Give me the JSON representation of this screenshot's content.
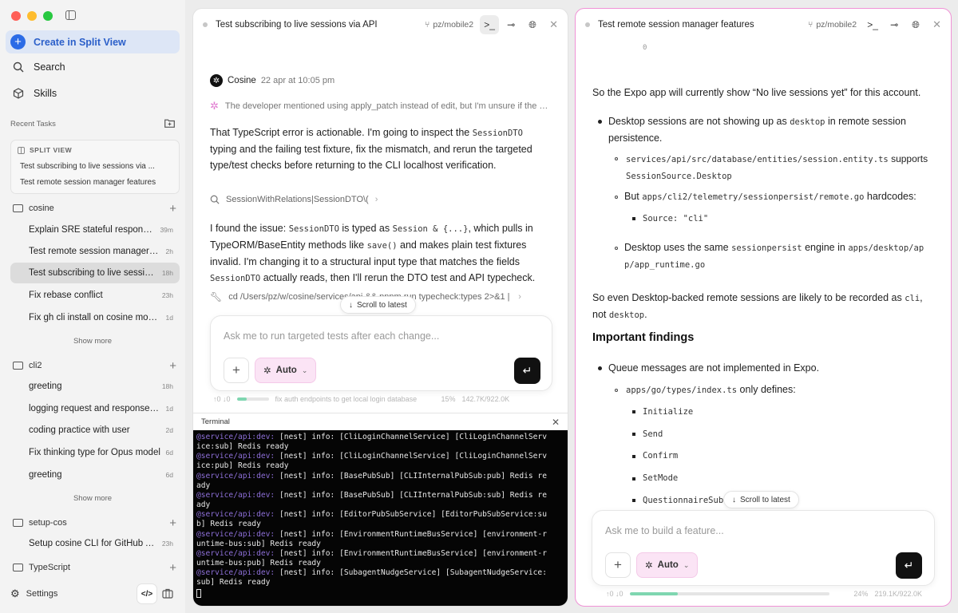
{
  "sidebar": {
    "create_label": "Create in Split View",
    "nav": [
      {
        "label": "Search",
        "icon": "search-icon"
      },
      {
        "label": "Skills",
        "icon": "cube-icon"
      }
    ],
    "recent_tasks_label": "Recent Tasks",
    "split_view": {
      "label": "SPLIT VIEW",
      "items": [
        "Test subscribing to live sessions via ...",
        "Test remote session manager features"
      ]
    },
    "groups": [
      {
        "name": "cosine",
        "tasks": [
          {
            "title": "Explain SRE stateful responses...",
            "age": "39m"
          },
          {
            "title": "Test remote session manager fea...",
            "age": "2h"
          },
          {
            "title": "Test subscribing to live sessions...",
            "age": "18h",
            "selected": true
          },
          {
            "title": "Fix rebase conflict",
            "age": "23h"
          },
          {
            "title": "Fix gh cli install on cosine monor...",
            "age": "1d"
          }
        ],
        "show_more": "Show more"
      },
      {
        "name": "cli2",
        "tasks": [
          {
            "title": "greeting",
            "age": "18h"
          },
          {
            "title": "logging request and response de...",
            "age": "1d"
          },
          {
            "title": "coding practice with user",
            "age": "2d"
          },
          {
            "title": "Fix thinking type for Opus model",
            "age": "6d"
          },
          {
            "title": "greeting",
            "age": "6d"
          }
        ],
        "show_more": "Show more"
      },
      {
        "name": "setup-cos",
        "tasks": [
          {
            "title": "Setup cosine CLI for GitHub Acti...",
            "age": "23h"
          }
        ]
      },
      {
        "name": "TypeScript",
        "tasks": []
      }
    ],
    "settings_label": "Settings"
  },
  "left_panel": {
    "title": "Test subscribing to live sessions via API",
    "branch": "pz/mobile2",
    "author": "Cosine",
    "timestamp": "22 apr at 10:05 pm",
    "thinking": "The developer mentioned using apply_patch instead of edit, but I'm unsure if the edit...",
    "msg1": {
      "a": "That TypeScript error is actionable. I'm going to inspect the ",
      "code": "SessionDTO",
      "b": "typing and the failing test fixture, fix the mismatch, and rerun the targeted type/test checks before returning to the CLI localhost verification."
    },
    "search_tool": "SessionWithRelations|SessionDTO\\(",
    "msg2": {
      "a": "I found the issue: ",
      "c1": "SessionDTO",
      "b": " is typed as ",
      "c2": "Session & {...}",
      "c": ", which pulls in TypeORM/BaseEntity methods like ",
      "c3": "save()",
      "d": " and makes plain test fixtures invalid. I'm changing it to a structural input type that matches the fields ",
      "c4a": "Sessio",
      "c4b": "nDTO",
      "e": " actually reads, then I'll rerun the DTO test and API typecheck."
    },
    "cmd_tool": "cd /Users/pz/w/cosine/services/api && pnpm run typecheck:types 2>&1 | tail -60",
    "scroll_label": "Scroll to latest",
    "composer_placeholder": "Ask me to run targeted tests after each change...",
    "mode_label": "Auto",
    "status": {
      "counts": "↑0 ↓0",
      "progress": 0.3,
      "note": "fix auth endpoints to get local login database",
      "percent": "15%",
      "tokens": "142.7K/922.0K"
    },
    "terminal_title": "Terminal",
    "terminal_lines": [
      {
        "label": "@service/api:dev:",
        "text": " [nest] info: [CliLoginChannelService] [CliLoginChannelServ"
      },
      {
        "label": "",
        "text": "ice:sub] Redis ready"
      },
      {
        "label": "@service/api:dev:",
        "text": " [nest] info: [CliLoginChannelService] [CliLoginChannelServ"
      },
      {
        "label": "",
        "text": "ice:pub] Redis ready"
      },
      {
        "label": "@service/api:dev:",
        "text": " [nest] info: [BasePubSub] [CLIInternalPubSub:pub] Redis re"
      },
      {
        "label": "",
        "text": "ady"
      },
      {
        "label": "@service/api:dev:",
        "text": " [nest] info: [BasePubSub] [CLIInternalPubSub:sub] Redis re"
      },
      {
        "label": "",
        "text": "ady"
      },
      {
        "label": "@service/api:dev:",
        "text": " [nest] info: [EditorPubSubService] [EditorPubSubService:su"
      },
      {
        "label": "",
        "text": "b] Redis ready"
      },
      {
        "label": "@service/api:dev:",
        "text": " [nest] info: [EnvironmentRuntimeBusService] [environment-r"
      },
      {
        "label": "",
        "text": "untime-bus:sub] Redis ready"
      },
      {
        "label": "@service/api:dev:",
        "text": " [nest] info: [EnvironmentRuntimeBusService] [environment-r"
      },
      {
        "label": "",
        "text": "untime-bus:pub] Redis ready"
      },
      {
        "label": "@service/api:dev:",
        "text": " [nest] info: [SubagentNudgeService] [SubagentNudgeService:"
      },
      {
        "label": "",
        "text": "sub] Redis ready"
      }
    ]
  },
  "right_panel": {
    "title": "Test remote session manager features",
    "branch": "pz/mobile2",
    "top_fragment": "0",
    "p1": "So the Expo app will currently show “No live sessions yet” for this account.",
    "b1": {
      "a": "Desktop sessions are not showing up as ",
      "code": "desktop",
      "b": " in remote session persistence."
    },
    "b1_1": {
      "code": "services/api/src/database/entities/session.entity.ts",
      "a": " supports",
      "code2": "SessionSource.Desktop"
    },
    "b1_2": {
      "a": "But ",
      "code": "apps/cli2/telemetry/sessionpersist/remote.go",
      "b": " hardcodes:"
    },
    "b1_2_1": "Source: \"cli\"",
    "b1_3": {
      "a": "Desktop uses the same ",
      "code": "sessionpersist",
      "b": " engine in ",
      "code2a": "apps/desktop/ap",
      "code2b": "p/app_runtime.go"
    },
    "p2": {
      "a": "So even Desktop-backed remote sessions are likely to be recorded as ",
      "code": "cli",
      "b": ",",
      "c": "not ",
      "code2": "desktop",
      "d": "."
    },
    "heading": "Important findings",
    "b2": "Queue messages are not implemented in Expo.",
    "b2_1": {
      "code": "apps/go/types/index.ts",
      "a": " only defines:"
    },
    "b2_items": [
      "Initialize",
      "Send",
      "Confirm",
      "SetMode",
      "QuestionnaireSub"
    ],
    "scroll_label": "Scroll to latest",
    "composer_placeholder": "Ask me to build a feature...",
    "mode_label": "Auto",
    "status": {
      "counts": "↑0 ↓0",
      "progress": 0.24,
      "percent": "24%",
      "tokens": "219.1K/922.0K"
    }
  }
}
